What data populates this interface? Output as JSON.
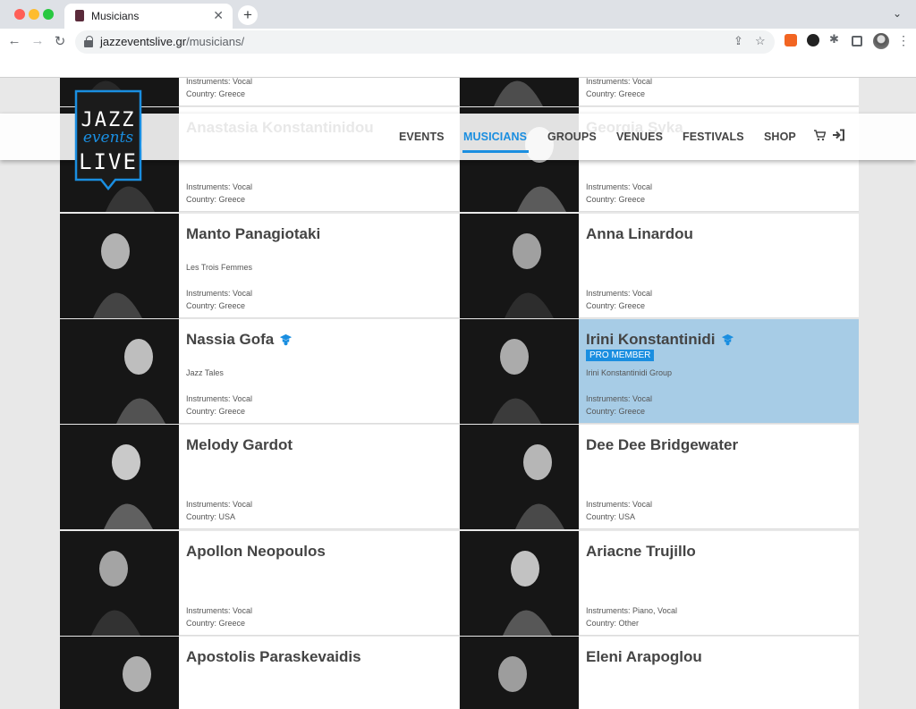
{
  "browser": {
    "tab_title": "Musicians",
    "url_host": "jazzeventslive.gr",
    "url_path": "/musicians/"
  },
  "site": {
    "logo_text": [
      "JAZZ",
      "events",
      "LIVE"
    ],
    "nav": [
      "EVENTS",
      "MUSICIANS",
      "GROUPS",
      "VENUES",
      "FESTIVALS",
      "SHOP"
    ],
    "active_nav": "MUSICIANS",
    "accent_color": "#1a8ee0",
    "highlight_color": "#a7cce6"
  },
  "musicians": [
    {
      "name": "",
      "group": "",
      "instruments": "Instruments: Vocal",
      "country": "Country: Greece",
      "pro": false
    },
    {
      "name": "",
      "group": "",
      "instruments": "Instruments: Vocal",
      "country": "Country: Greece",
      "pro": false
    },
    {
      "name": "Anastasia Konstantinidou",
      "group": "",
      "instruments": "Instruments: Vocal",
      "country": "Country: Greece",
      "pro": false
    },
    {
      "name": "Georgia Syka",
      "group": "",
      "instruments": "Instruments: Vocal",
      "country": "Country: Greece",
      "pro": false
    },
    {
      "name": "Manto Panagiotaki",
      "group": "Les Trois Femmes",
      "instruments": "Instruments: Vocal",
      "country": "Country: Greece",
      "pro": false
    },
    {
      "name": "Anna Linardou",
      "group": "",
      "instruments": "Instruments: Vocal",
      "country": "Country: Greece",
      "pro": false
    },
    {
      "name": "Nassia Gofa",
      "group": "Jazz Tales",
      "instruments": "Instruments: Vocal",
      "country": "Country: Greece",
      "pro": false,
      "cap": true
    },
    {
      "name": "Irini Konstantinidi",
      "group": "Irini Konstantinidi Group",
      "instruments": "Instruments: Vocal",
      "country": "Country: Greece",
      "pro": true,
      "badge": "PRO MEMBER",
      "cap": true
    },
    {
      "name": "Melody Gardot",
      "group": "",
      "instruments": "Instruments: Vocal",
      "country": "Country: USA",
      "pro": false
    },
    {
      "name": "Dee Dee Bridgewater",
      "group": "",
      "instruments": "Instruments: Vocal",
      "country": "Country: USA",
      "pro": false
    },
    {
      "name": "Apollon Neopoulos",
      "group": "",
      "instruments": "Instruments: Vocal",
      "country": "Country: Greece",
      "pro": false
    },
    {
      "name": "Ariacne Trujillo",
      "group": "",
      "instruments": "Instruments: Piano, Vocal",
      "country": "Country: Other",
      "pro": false
    },
    {
      "name": "Apostolis Paraskevaidis",
      "group": "",
      "instruments": "",
      "country": "",
      "pro": false
    },
    {
      "name": "Eleni Arapoglou",
      "group": "",
      "instruments": "",
      "country": "",
      "pro": false
    }
  ]
}
